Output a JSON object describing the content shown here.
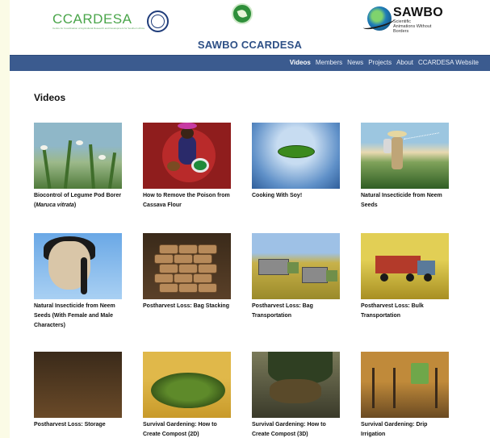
{
  "header": {
    "ccardesa_logo": "CCARDESA",
    "ccardesa_tagline": "Centre for Coordination of Agricultural Research and Development for Southern Africa",
    "sawbo_logo": "SAWBO",
    "sawbo_tagline": "Scientific Animations Without Borders",
    "site_title": "SAWBO CCARDESA"
  },
  "nav": {
    "items": [
      "Videos",
      "Members",
      "News",
      "Projects",
      "About",
      "CCARDESA Website"
    ],
    "active": "Videos"
  },
  "main": {
    "section_title": "Videos",
    "videos": [
      {
        "title": "Biocontrol of Legume Pod Borer (",
        "title_italic": "Maruca vitrata",
        "title_end": ")",
        "thumb_icon": "legume-plant-thumbnail"
      },
      {
        "title": "How to Remove the Poison from Cassava Flour",
        "thumb_icon": "cassava-woman-thumbnail"
      },
      {
        "title": "Cooking With Soy!",
        "thumb_icon": "soy-pod-thumbnail"
      },
      {
        "title": "Natural Insecticide from Neem Seeds",
        "thumb_icon": "farmer-spraying-thumbnail"
      },
      {
        "title": "Natural Insecticide from Neem Seeds (With Female and Male Characters)",
        "thumb_icon": "female-character-thumbnail"
      },
      {
        "title": "Postharvest Loss: Bag Stacking",
        "thumb_icon": "bag-stack-thumbnail"
      },
      {
        "title": "Postharvest Loss: Bag Transportation",
        "thumb_icon": "trucks-thumbnail"
      },
      {
        "title": "Postharvest Loss: Bulk Transportation",
        "thumb_icon": "truck-bulk-thumbnail"
      },
      {
        "title": "Postharvest Loss: Storage",
        "thumb_icon": "storage-bags-thumbnail"
      },
      {
        "title": "Survival Gardening: How to Create Compost (2D)",
        "thumb_icon": "compost-2d-thumbnail"
      },
      {
        "title": "Survival Gardening: How to Create Compost (3D)",
        "thumb_icon": "compost-3d-thumbnail"
      },
      {
        "title": "Survival Gardening: Drip Irrigation",
        "thumb_icon": "drip-irrigation-thumbnail"
      }
    ]
  },
  "colors": {
    "nav_bar": "#3b5b8f",
    "title_blue": "#2e5086",
    "ccardesa_green": "#4aa54a"
  }
}
